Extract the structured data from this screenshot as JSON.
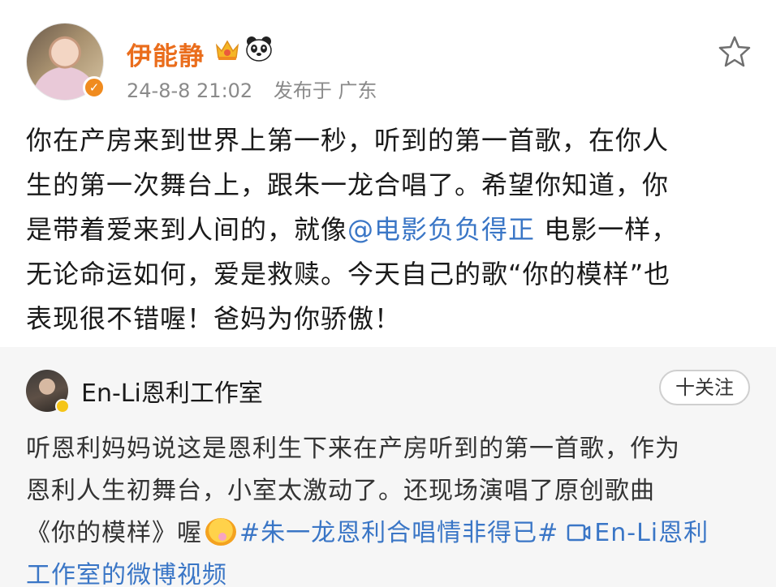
{
  "post": {
    "author": "伊能静",
    "meta_time": "24-8-8 21:02",
    "meta_location": "发布于 广东",
    "lines": {
      "l1": "你在产房来到世界上第一秒，听到的第一首歌，在你人",
      "l2": "生的第一次舞台上，跟朱一龙合唱了。希望你知道，你",
      "l3_before": "是带着爱来到人间的，就像",
      "l3_mention": "@电影负负得正",
      "l3_after": " 电影一样，",
      "l4": "无论命运如何，爱是救赎。今天自己的歌“你的模样”也",
      "l5": "表现很不错喔！爸妈为你骄傲！"
    },
    "icons": {
      "verified": "verified-badge-icon",
      "crown": "crown-icon",
      "panda": "panda-icon",
      "favorite": "star-icon"
    },
    "colors": {
      "author": "#ea6d1c",
      "link": "#3a76c6"
    }
  },
  "repost": {
    "author": "En-Li恩利工作室",
    "follow_label": "十关注",
    "lines": {
      "l1": "听恩利妈妈说这是恩利生下来在产房听到的第一首歌，作为",
      "l2": "恩利人生初舞台，小室太激动了。还现场演唱了原创歌曲",
      "l3_before": "《你的模样》喔",
      "l3_hashtag": "#朱一龙恩利合唱情非得已#",
      "l3_link": "En-Li恩利",
      "l4_link": "工作室的微博视频"
    },
    "icons": {
      "emoji": "happy-emoji-icon",
      "video": "video-link-icon"
    },
    "colors": {
      "background": "#f6f6f6"
    }
  }
}
